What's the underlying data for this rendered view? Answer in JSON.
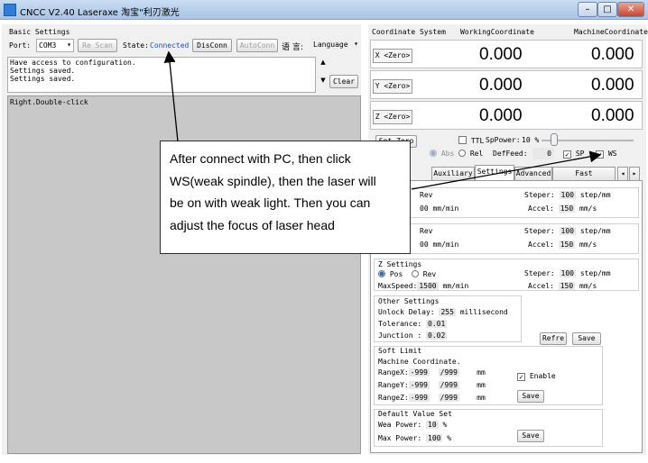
{
  "window": {
    "title": "CNCC V2.40  Laseraxe    淘宝\"利刃激光"
  },
  "basic": {
    "title": "Basic Settings",
    "port_label": "Port:",
    "port_value": "COM3",
    "rescan_label": "Re Scan",
    "state_label": "State:",
    "state_value": "Connected",
    "disconn_label": "DisConn",
    "autoconn_label": "AutoConn",
    "lang_label": "语 言:",
    "lang_value": "Language",
    "log_lines": [
      "Have access to configuration.",
      "Settings saved.",
      "Settings saved."
    ],
    "clear_label": "Clear",
    "canvas_hint": "Right.Double-click"
  },
  "coords": {
    "header_system": "Coordinate System",
    "header_working": "WorkingCoordinate",
    "header_machine": "MachineCoordinate",
    "rows": [
      {
        "label": "X <Zero>",
        "working": "0.000",
        "machine": "0.000"
      },
      {
        "label": "Y <Zero>",
        "working": "0.000",
        "machine": "0.000"
      },
      {
        "label": "Z <Zero>",
        "working": "0.000",
        "machine": "0.000"
      }
    ]
  },
  "controls": {
    "set_zero": "Set Zero",
    "ttl": "TTL",
    "sp_power_label": "SpPower:",
    "sp_power_value": "10 %",
    "abs": "Abs",
    "rel": "Rel",
    "def_feed_label": "DefFeed:",
    "def_feed_value": "0",
    "sp_check": "SP",
    "ws_check": "WS"
  },
  "tabs": [
    "Auxiliary",
    "Settings",
    "Advanced",
    "Fast Processing"
  ],
  "settings": {
    "x": {
      "rev": "Rev",
      "speed_tail": "00",
      "speed_unit": "mm/min",
      "steper_label": "Steper:",
      "steper_value": "100",
      "steper_unit": "step/mm",
      "accel_label": "Accel:",
      "accel_value": "150",
      "accel_unit": "mm/s"
    },
    "y": {
      "rev": "Rev",
      "speed_tail": "00",
      "speed_unit": "mm/min",
      "steper_label": "Steper:",
      "steper_value": "100",
      "steper_unit": "step/mm",
      "accel_label": "Accel:",
      "accel_value": "150",
      "accel_unit": "mm/s"
    },
    "z": {
      "title": "Z Settings",
      "pos": "Pos",
      "rev": "Rev",
      "maxspeed_label": "MaxSpeed:",
      "maxspeed_value": "1500",
      "speed_unit": "mm/min",
      "steper_label": "Steper:",
      "steper_value": "100",
      "steper_unit": "step/mm",
      "accel_label": "Accel:",
      "accel_value": "150",
      "accel_unit": "mm/s"
    },
    "other": {
      "title": "Other Settings",
      "unlock_label": "Unlock Delay:",
      "unlock_value": "255",
      "unlock_unit": "millisecond",
      "tolerance_label": "Tolerance:",
      "tolerance_value": "0.01",
      "junction_label": "Junction :",
      "junction_value": "0.02",
      "refresh": "Refre",
      "save": "Save"
    },
    "soft_limit": {
      "title": "Soft Limit",
      "machine_coord": "Machine Coordinate.",
      "range_x_label": "RangeX:",
      "range_y_label": "RangeY:",
      "range_z_label": "RangeZ:",
      "range_min": "-999",
      "range_max": "/999",
      "range_unit": "mm",
      "enable": "Enable",
      "save": "Save"
    },
    "defaults": {
      "title": "Default Value Set",
      "wea_label": "Wea Power:",
      "wea_value": "10",
      "max_label": "Max Power:",
      "max_value": "100",
      "unit": "%",
      "save": "Save"
    }
  },
  "callout": {
    "lines": [
      "After connect with PC, then click",
      "WS(weak spindle), then the laser will",
      "be on with weak light. Then you can",
      "adjust the focus of laser head"
    ]
  }
}
